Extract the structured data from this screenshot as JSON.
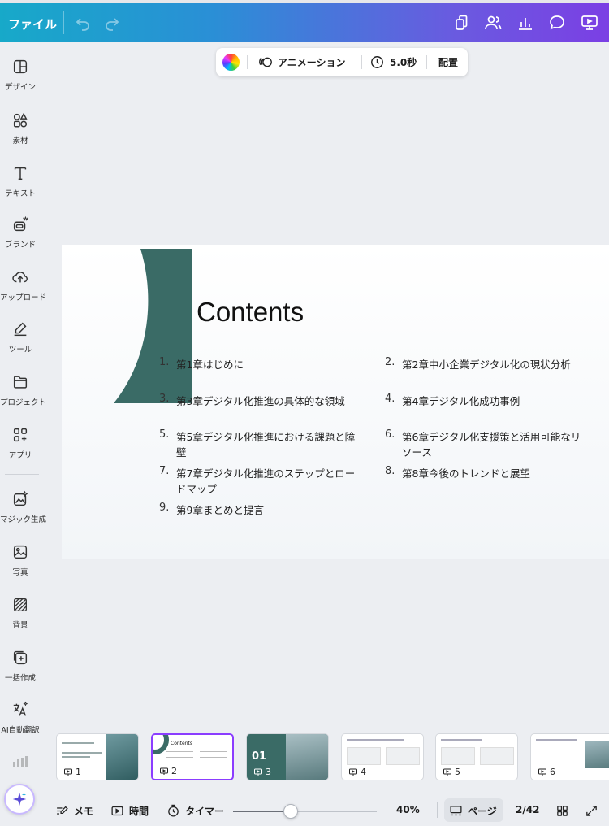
{
  "topbar": {
    "file_label": "ファイル",
    "icons": [
      "undo-icon",
      "redo-icon",
      "copy-icon",
      "share-people-icon",
      "insights-chart-icon",
      "comment-icon",
      "present-icon"
    ]
  },
  "sidebar": {
    "items": [
      {
        "label": "デザイン",
        "icon": "design-icon"
      },
      {
        "label": "素材",
        "icon": "elements-icon"
      },
      {
        "label": "テキスト",
        "icon": "text-icon"
      },
      {
        "label": "ブランド",
        "icon": "brand-icon"
      },
      {
        "label": "アップロード",
        "icon": "upload-icon"
      },
      {
        "label": "ツール",
        "icon": "draw-icon"
      },
      {
        "label": "プロジェクト",
        "icon": "folder-icon"
      },
      {
        "label": "アプリ",
        "icon": "apps-icon"
      },
      {
        "label": "マジック生成",
        "icon": "magic-media-icon"
      },
      {
        "label": "写真",
        "icon": "photo-icon"
      },
      {
        "label": "背景",
        "icon": "background-icon"
      },
      {
        "label": "一括作成",
        "icon": "bulk-create-icon"
      },
      {
        "label": "AI自動翻訳",
        "icon": "translate-icon"
      }
    ]
  },
  "toolbar": {
    "animation_label": "アニメーション",
    "duration_label": "5.0秒",
    "position_label": "配置"
  },
  "slide": {
    "title": "Contents",
    "toc": [
      {
        "num": "1.",
        "text": "第1章はじめに"
      },
      {
        "num": "2.",
        "text": "第2章中小企業デジタル化の現状分析"
      },
      {
        "num": "3.",
        "text": "第3章デジタル化推進の具体的な領域"
      },
      {
        "num": "4.",
        "text": "第4章デジタル化成功事例"
      },
      {
        "num": "5.",
        "text": "第5章デジタル化推進における課題と障壁"
      },
      {
        "num": "6.",
        "text": "第6章デジタル化支援策と活用可能なリソース"
      },
      {
        "num": "7.",
        "text": "第7章デジタル化推進のステップとロードマップ"
      },
      {
        "num": "8.",
        "text": "第8章今後のトレンドと展望"
      },
      {
        "num": "9.",
        "text": "第9章まとめと提言"
      }
    ],
    "accent_color": "#3a6b66"
  },
  "thumbnails": [
    {
      "num": "1",
      "selected": false
    },
    {
      "num": "2",
      "selected": true
    },
    {
      "num": "3",
      "selected": false,
      "label": "01"
    },
    {
      "num": "4",
      "selected": false
    },
    {
      "num": "5",
      "selected": false
    },
    {
      "num": "6",
      "selected": false
    }
  ],
  "bottombar": {
    "notes_label": "メモ",
    "time_label": "時間",
    "timer_label": "タイマー",
    "zoom_value": 0.4,
    "zoom_label": "40%",
    "pages_label": "ページ",
    "page_count": "2/42"
  }
}
